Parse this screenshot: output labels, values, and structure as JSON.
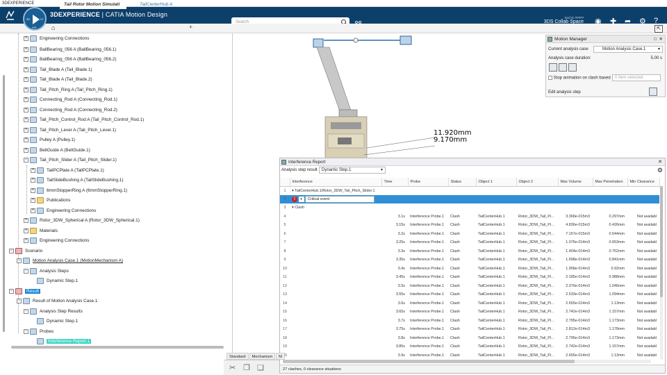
{
  "window": {
    "title": "3DEXPERIENCE"
  },
  "topbar": {
    "brand_prefix": "3DEXPERIENCE",
    "brand_suffix": "| CATIA Motion Design",
    "compass_version": "V.R",
    "compass_left": "3D",
    "compass_right": "V+",
    "search_placeholder": "Search",
    "user_name": "Sachin #####",
    "space": "3DS Collab Space"
  },
  "tabs": [
    {
      "label": "Tail Rotor Motion Simulati"
    },
    {
      "label": "TailCenterHub A"
    }
  ],
  "tree": {
    "items": [
      {
        "label": "Engineering Connections"
      },
      {
        "label": "BallBearing_056 A (BallBearing_056.1)"
      },
      {
        "label": "BallBearing_056 A (BallBearing_056.2)"
      },
      {
        "label": "Tail_Blade A (Tail_Blade.1)"
      },
      {
        "label": "Tail_Blade A (Tail_Blade.2)"
      },
      {
        "label": "Tail_Pitch_Ring A (Tail_Pitch_Ring.1)"
      },
      {
        "label": "Connecting_Rod A (Connecting_Rod.1)"
      },
      {
        "label": "Connecting_Rod A (Connecting_Rod.2)"
      },
      {
        "label": "Tail_Pitch_Control_Rod A (Tail_Pitch_Control_Rod.1)"
      },
      {
        "label": "Tail_Pitch_Lever A (Tail_Pitch_Lever.1)"
      },
      {
        "label": "Pulley A (Pulley.1)"
      },
      {
        "label": "BeltGuide A (BeltGuide.1)"
      },
      {
        "label": "Tail_Pitch_Slider A (Tail_Pitch_Slider.1)"
      },
      {
        "label": "TailPCPlate A (TailPCPlate.1)"
      },
      {
        "label": "TailSlideBushing A (TailSlideBushing.1)"
      },
      {
        "label": "6mmStopperRing A (6mmStopperRing.1)"
      },
      {
        "label": "Publications"
      },
      {
        "label": "Engineering Connections"
      },
      {
        "label": "Rotor_3DW_Spherical A (Rotor_3DW_Spherical.1)"
      },
      {
        "label": "Materials"
      },
      {
        "label": "Engineering Connections"
      },
      {
        "label": "Scenario"
      },
      {
        "label": "Motion Analysis Case.1 (MotionMechanism A)"
      },
      {
        "label": "Analysis Steps"
      },
      {
        "label": "Dynamic Step.1"
      },
      {
        "label": "Result"
      },
      {
        "label": "Result of Motion Analysis Case.1"
      },
      {
        "label": "Analysis Step Results"
      },
      {
        "label": "Dynamic Step.1"
      },
      {
        "label": "Probes"
      },
      {
        "label": "Interference Report.1"
      }
    ]
  },
  "viewport": {
    "dim1": "11.920mm",
    "dim2": "9.170mm"
  },
  "motion_manager": {
    "title": "Motion Manager",
    "current_case_label": "Current analysis case",
    "current_case_value": "Motion Analysis Case.1",
    "duration_label": "Analysis case duration:",
    "duration_value": "5.00 s",
    "stop_label": "Stop animation on clash based",
    "stop_value": "0 item selected",
    "edit_label": "Edit analysis step"
  },
  "interference_report": {
    "title": "Interference Report",
    "step_label": "Analysis step result",
    "step_value": "Dynamic Step.1",
    "columns": [
      "",
      "Interference",
      "Time",
      "Probe",
      "Status",
      "Object 1",
      "Object 2",
      "Max Volume",
      "Max Penetration",
      "Min Clearance"
    ],
    "group_row": {
      "idx": "1",
      "label": "TailCenterHub.1/Rotor_3DW_Tail_Pitch_Slider.1"
    },
    "selected_row": {
      "idx": "2",
      "edit_value": "Critical event"
    },
    "clash_group": {
      "idx": "3",
      "label": "Clash"
    },
    "rows": [
      {
        "idx": "4",
        "time": "3.1s",
        "probe": "Interference Probe.1",
        "status": "Clash",
        "obj1": "TailCenterHub.1",
        "obj2": "Rotor_3DW_Tail_Pi...",
        "vol": "3.368e-015m3",
        "pen": "0.297mm",
        "clr": "Not availabl"
      },
      {
        "idx": "5",
        "time": "3.15s",
        "probe": "Interference Probe.1",
        "status": "Clash",
        "obj1": "TailCenterHub.1",
        "obj2": "Rotor_3DW_Tail_Pi...",
        "vol": "4.836e-015m3",
        "pen": "0.426mm",
        "clr": "Not availabl"
      },
      {
        "idx": "6",
        "time": "3.2s",
        "probe": "Interference Probe.1",
        "status": "Clash",
        "obj1": "TailCenterHub.1",
        "obj2": "Rotor_3DW_Tail_Pi...",
        "vol": "7.157e-015m3",
        "pen": "0.544mm",
        "clr": "Not availabl"
      },
      {
        "idx": "7",
        "time": "3.25s",
        "probe": "Interference Probe.1",
        "status": "Clash",
        "obj1": "TailCenterHub.1",
        "obj2": "Rotor_3DW_Tail_Pi...",
        "vol": "1.076e-014m3",
        "pen": "0.653mm",
        "clr": "Not availabl"
      },
      {
        "idx": "8",
        "time": "3.3s",
        "probe": "Interference Probe.1",
        "status": "Clash",
        "obj1": "TailCenterHub.1",
        "obj2": "Rotor_3DW_Tail_Pi...",
        "vol": "1.404e-014m3",
        "pen": "0.752mm",
        "clr": "Not availabl"
      },
      {
        "idx": "9",
        "time": "3.35s",
        "probe": "Interference Probe.1",
        "status": "Clash",
        "obj1": "TailCenterHub.1",
        "obj2": "Rotor_3DW_Tail_Pi...",
        "vol": "1.698e-014m3",
        "pen": "0.841mm",
        "clr": "Not availabl"
      },
      {
        "idx": "10",
        "time": "3.4s",
        "probe": "Interference Probe.1",
        "status": "Clash",
        "obj1": "TailCenterHub.1",
        "obj2": "Rotor_3DW_Tail_Pi...",
        "vol": "1.958e-014m3",
        "pen": "0.92mm",
        "clr": "Not availabl"
      },
      {
        "idx": "11",
        "time": "3.45s",
        "probe": "Interference Probe.1",
        "status": "Clash",
        "obj1": "TailCenterHub.1",
        "obj2": "Rotor_3DW_Tail_Pi...",
        "vol": "2.185e-014m3",
        "pen": "0.988mm",
        "clr": "Not availabl"
      },
      {
        "idx": "12",
        "time": "3.5s",
        "probe": "Interference Probe.1",
        "status": "Clash",
        "obj1": "TailCenterHub.1",
        "obj2": "Rotor_3DW_Tail_Pi...",
        "vol": "2.376e-014m3",
        "pen": "1.046mm",
        "clr": "Not availabl"
      },
      {
        "idx": "13",
        "time": "3.55s",
        "probe": "Interference Probe.1",
        "status": "Clash",
        "obj1": "TailCenterHub.1",
        "obj2": "Rotor_3DW_Tail_Pi...",
        "vol": "2.533e-014m3",
        "pen": "1.094mm",
        "clr": "Not availabl"
      },
      {
        "idx": "14",
        "time": "3.6s",
        "probe": "Interference Probe.1",
        "status": "Clash",
        "obj1": "TailCenterHub.1",
        "obj2": "Rotor_3DW_Tail_Pi...",
        "vol": "2.655e-014m3",
        "pen": "1.13mm",
        "clr": "Not availabl"
      },
      {
        "idx": "15",
        "time": "3.65s",
        "probe": "Interference Probe.1",
        "status": "Clash",
        "obj1": "TailCenterHub.1",
        "obj2": "Rotor_3DW_Tail_Pi...",
        "vol": "2.742e-014m3",
        "pen": "1.157mm",
        "clr": "Not availabl"
      },
      {
        "idx": "16",
        "time": "3.7s",
        "probe": "Interference Probe.1",
        "status": "Clash",
        "obj1": "TailCenterHub.1",
        "obj2": "Rotor_3DW_Tail_Pi...",
        "vol": "2.795e-014m3",
        "pen": "1.173mm",
        "clr": "Not availabl"
      },
      {
        "idx": "17",
        "time": "3.75s",
        "probe": "Interference Probe.1",
        "status": "Clash",
        "obj1": "TailCenterHub.1",
        "obj2": "Rotor_3DW_Tail_Pi...",
        "vol": "2.812e-014m3",
        "pen": "1.178mm",
        "clr": "Not availabl"
      },
      {
        "idx": "18",
        "time": "3.8s",
        "probe": "Interference Probe.1",
        "status": "Clash",
        "obj1": "TailCenterHub.1",
        "obj2": "Rotor_3DW_Tail_Pi...",
        "vol": "2.795e-014m3",
        "pen": "1.173mm",
        "clr": "Not availabl"
      },
      {
        "idx": "19",
        "time": "3.85s",
        "probe": "Interference Probe.1",
        "status": "Clash",
        "obj1": "TailCenterHub.1",
        "obj2": "Rotor_3DW_Tail_Pi...",
        "vol": "2.742e-014m3",
        "pen": "1.157mm",
        "clr": "Not availabl"
      },
      {
        "idx": "20",
        "time": "3.9s",
        "probe": "Interference Probe.1",
        "status": "Clash",
        "obj1": "TailCenterHub.1",
        "obj2": "Rotor_3DW_Tail_Pi...",
        "vol": "2.655e-014m3",
        "pen": "1.13mm",
        "clr": "Not availabl"
      }
    ],
    "footer": "27 clashes, 0 clearance situations"
  },
  "bottom_tabs": [
    "Standard",
    "Mechanism",
    "M"
  ],
  "colors": {
    "topbar": "#0d3f6b",
    "selection": "#2f8fd6",
    "highlight": "#3cd5c0",
    "error": "#d12020"
  }
}
